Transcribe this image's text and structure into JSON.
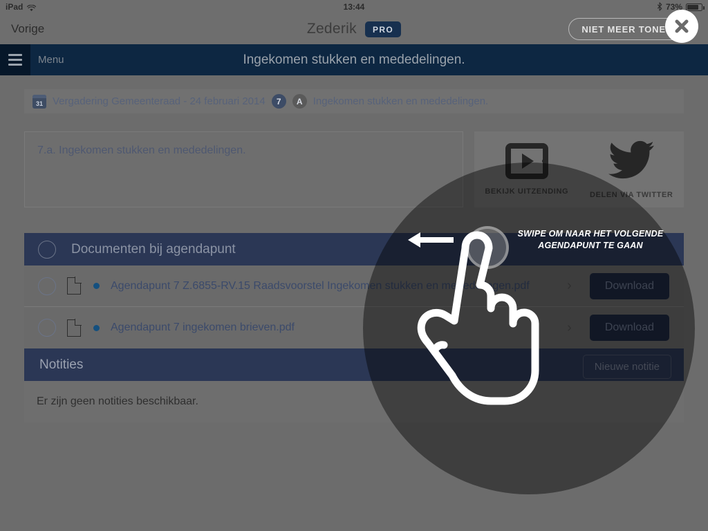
{
  "statusbar": {
    "device": "iPad",
    "wifi_icon": "wifi-icon",
    "time": "13:44",
    "bluetooth_icon": "bluetooth-icon",
    "battery_percent": "73%",
    "battery_icon": "battery-icon"
  },
  "navbar": {
    "back_label": "Vorige",
    "app_title": "Zederik",
    "pro_badge": "PRO"
  },
  "menubar": {
    "hamburger_icon": "hamburger-icon",
    "menu_label": "Menu",
    "page_title": "Ingekomen stukken en mededelingen."
  },
  "breadcrumb": {
    "calendar_icon_day": "31",
    "meeting": "Vergadering Gemeenteraad - 24 februari 2014",
    "item_number": "7",
    "item_letter": "A",
    "item_title": "Ingekomen stukken en mededelingen."
  },
  "description": {
    "text": "7.a. Ingekomen stukken en mededelingen."
  },
  "media": {
    "broadcast_icon": "tv-play-icon",
    "broadcast_label": "BEKIJK UITZENDING",
    "twitter_icon": "twitter-bird-icon",
    "twitter_label": "DELEN VIA TWITTER"
  },
  "documents": {
    "header_title": "Documenten bij agendapunt",
    "rows": [
      {
        "name": "Agendapunt 7 Z.6855-RV.15 Raadsvoorstel Ingekomen stukken en mededelingen.pdf",
        "download_label": "Download"
      },
      {
        "name": "Agendapunt 7 ingekomen brieven.pdf",
        "download_label": "Download"
      }
    ]
  },
  "notes": {
    "title": "Notities",
    "new_note_label": "Nieuwe notitie",
    "empty_text": "Er zijn geen notities beschikbaar."
  },
  "overlay": {
    "swipe_instruction": "SWIPE OM NAAR HET VOLGENDE AGENDAPUNT TE GAAN",
    "dismiss_label": "NIET MEER TONEN",
    "close_icon": "close-icon",
    "hand_icon": "hand-pointer-icon",
    "arrow_icon": "arrow-left-icon"
  },
  "colors": {
    "navy_dark": "#0d2742",
    "navy_darker": "#061729",
    "section_navy": "#2b3755",
    "accent_blue": "#14507f",
    "background_gray": "#6c6c6c"
  }
}
